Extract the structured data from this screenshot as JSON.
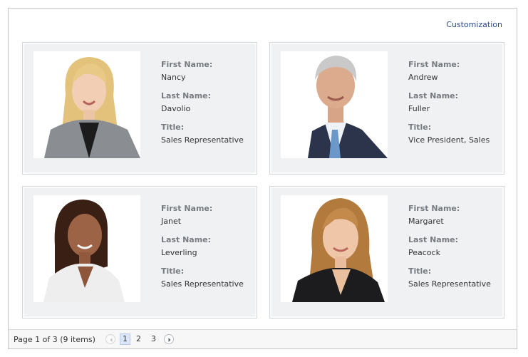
{
  "header": {
    "customization_link": "Customization"
  },
  "labels": {
    "first_name": "First Name:",
    "last_name": "Last Name:",
    "title": "Title:"
  },
  "cards": [
    {
      "first_name": "Nancy",
      "last_name": "Davolio",
      "title": "Sales Representative"
    },
    {
      "first_name": "Andrew",
      "last_name": "Fuller",
      "title": "Vice President, Sales"
    },
    {
      "first_name": "Janet",
      "last_name": "Leverling",
      "title": "Sales Representative"
    },
    {
      "first_name": "Margaret",
      "last_name": "Peacock",
      "title": "Sales Representative"
    }
  ],
  "pager": {
    "summary": "Page 1 of 3 (9 items)",
    "pages": [
      "1",
      "2",
      "3"
    ],
    "current_page": "1",
    "prev_icon": "chevron-left-icon",
    "next_icon": "chevron-right-icon"
  },
  "colors": {
    "link": "#2d4b8e",
    "card_bg": "#f0f1f3",
    "label": "#777b80",
    "active_page": "#dbe7f8"
  }
}
